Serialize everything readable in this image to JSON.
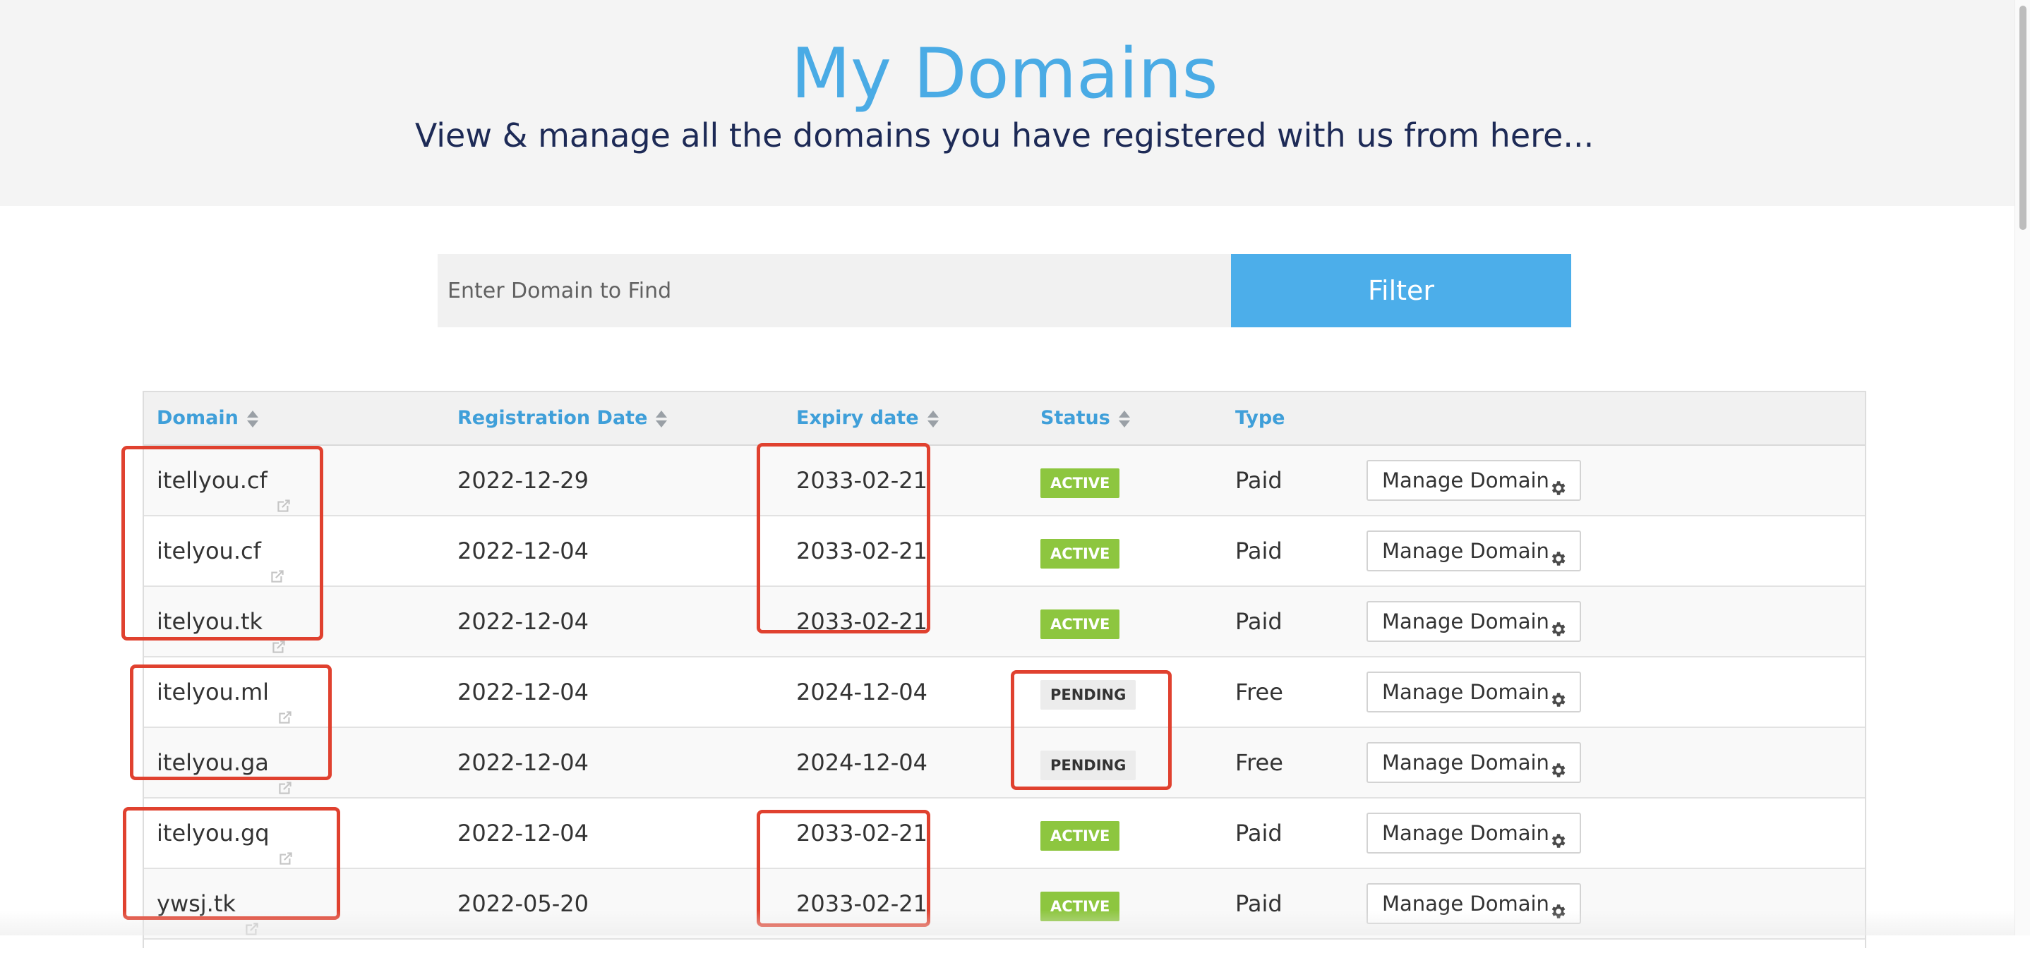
{
  "header": {
    "title": "My Domains",
    "subtitle": "View & manage all the domains you have registered with us from here..."
  },
  "search": {
    "placeholder": "Enter Domain to Find",
    "button_label": "Filter"
  },
  "table": {
    "columns": {
      "domain": "Domain",
      "registration_date": "Registration Date",
      "expiry_date": "Expiry date",
      "status": "Status",
      "type": "Type"
    },
    "manage_label": "Manage Domain",
    "rows": [
      {
        "domain": "itellyou.cf",
        "registration_date": "2022-12-29",
        "expiry_date": "2033-02-21",
        "status": "ACTIVE",
        "type": "Paid"
      },
      {
        "domain": "itelyou.cf",
        "registration_date": "2022-12-04",
        "expiry_date": "2033-02-21",
        "status": "ACTIVE",
        "type": "Paid"
      },
      {
        "domain": "itelyou.tk",
        "registration_date": "2022-12-04",
        "expiry_date": "2033-02-21",
        "status": "ACTIVE",
        "type": "Paid"
      },
      {
        "domain": "itelyou.ml",
        "registration_date": "2022-12-04",
        "expiry_date": "2024-12-04",
        "status": "PENDING",
        "type": "Free"
      },
      {
        "domain": "itelyou.ga",
        "registration_date": "2022-12-04",
        "expiry_date": "2024-12-04",
        "status": "PENDING",
        "type": "Free"
      },
      {
        "domain": "itelyou.gq",
        "registration_date": "2022-12-04",
        "expiry_date": "2033-02-21",
        "status": "ACTIVE",
        "type": "Paid"
      },
      {
        "domain": "ywsj.tk",
        "registration_date": "2022-05-20",
        "expiry_date": "2033-02-21",
        "status": "ACTIVE",
        "type": "Paid"
      }
    ]
  },
  "colors": {
    "title": "#4aabe5",
    "subtitle": "#1d2a56",
    "filter_button": "#4caeea",
    "column_header": "#3f9fd9",
    "status_active": "#8dc63f",
    "status_pending": "#ececec",
    "annotation": "#e0412f"
  }
}
